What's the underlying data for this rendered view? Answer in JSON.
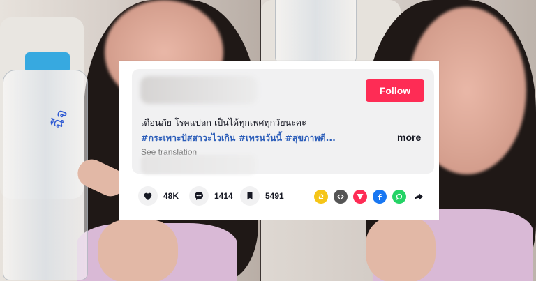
{
  "post": {
    "follow_label": "Follow",
    "caption": "เตือนภัย โรคแปลก เป็นได้ทุกเพศทุกวัยนะคะ",
    "hashtags": "#กระเพาะปัสสาวะไวเกิน #เทรนวันนี้ #สุขภาพดี...",
    "more_label": "more",
    "see_translation": "See translation"
  },
  "stats": {
    "likes": "48K",
    "comments": "1414",
    "saves": "5491"
  },
  "bottle_label": "ฉีจ",
  "colors": {
    "follow_bg": "#fe2c55",
    "hashtag": "#2b5db9",
    "repost": "#f5c518",
    "embed": "#555555",
    "send": "#fe2c55",
    "facebook": "#1877f2",
    "whatsapp": "#25d366"
  },
  "icons": [
    "heart-icon",
    "comment-icon",
    "bookmark-icon",
    "repost-icon",
    "embed-icon",
    "send-icon",
    "facebook-icon",
    "whatsapp-icon",
    "share-arrow-icon"
  ]
}
